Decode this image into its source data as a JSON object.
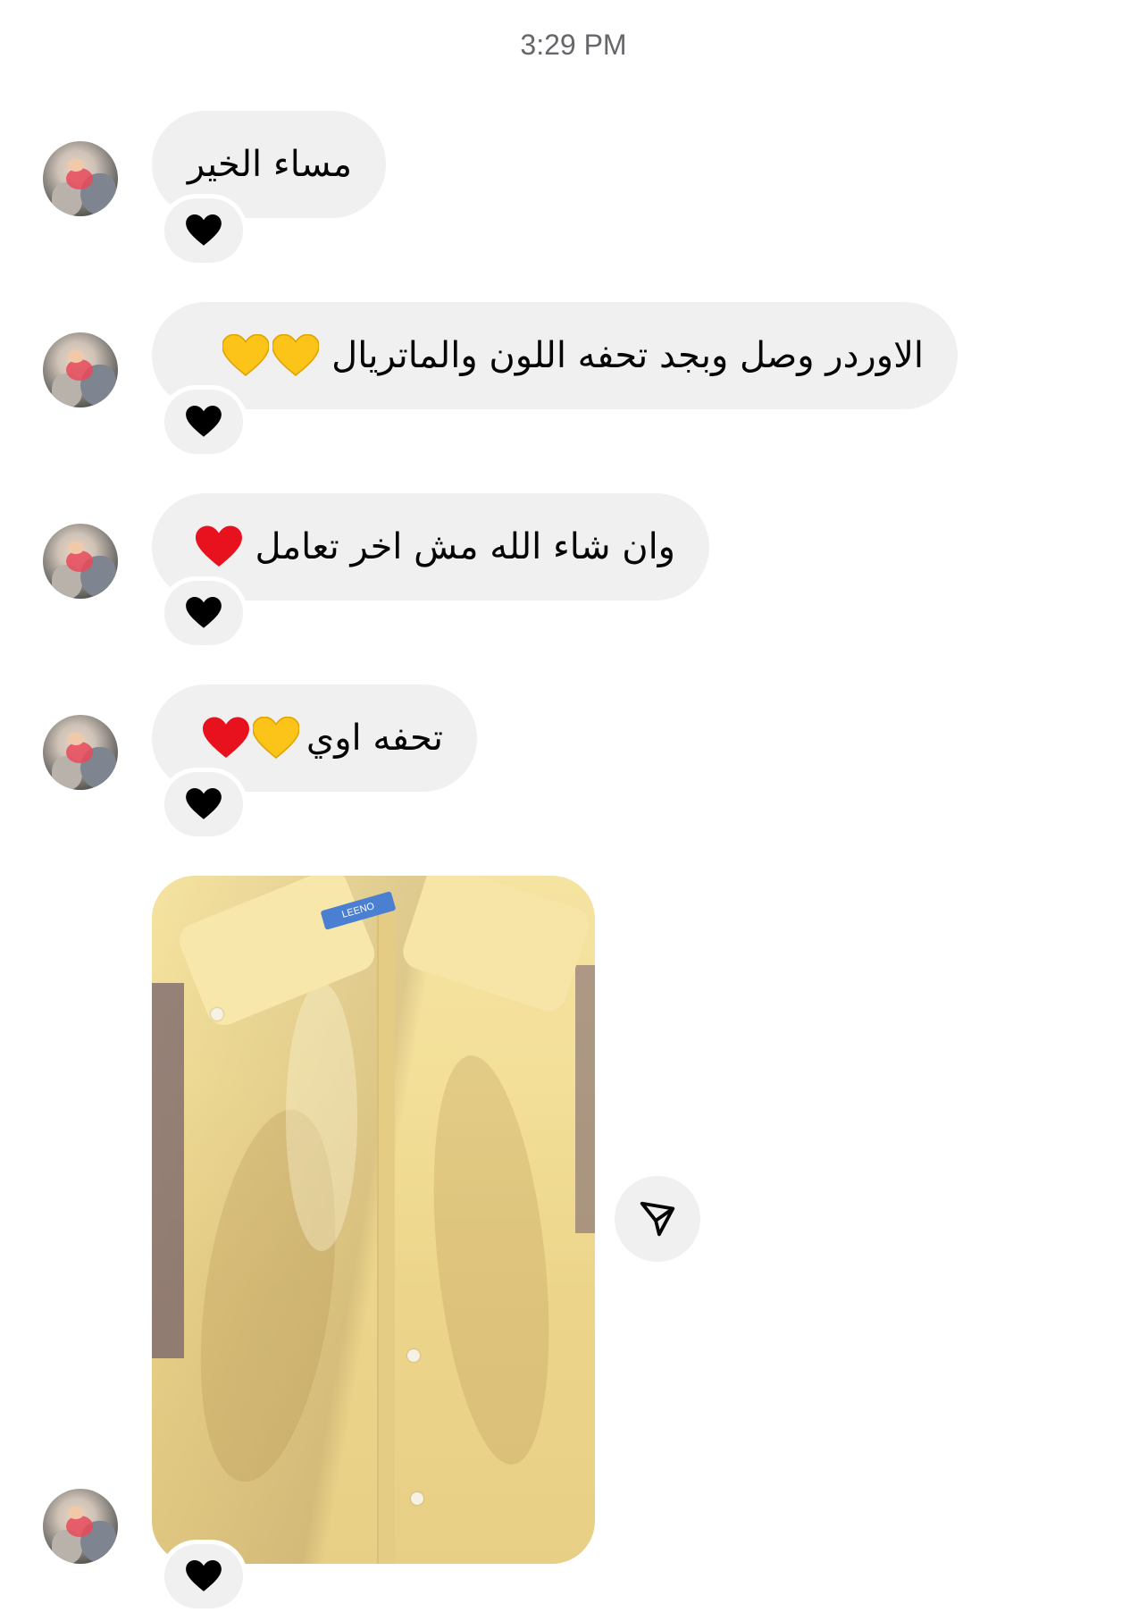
{
  "header": {
    "timestamp": "3:29 PM"
  },
  "messages": [
    {
      "text": "مساء الخير",
      "reaction": "red-heart"
    },
    {
      "text": "الاوردر وصل وبجد تحفه اللون والماتريال",
      "emojis": [
        "yellow-heart",
        "yellow-heart"
      ],
      "reaction": "red-heart"
    },
    {
      "text": "وان شاء الله مش اخر تعامل",
      "emojis": [
        "red-heart"
      ],
      "reaction": "red-heart"
    },
    {
      "text": "تحفه اوي",
      "emojis": [
        "yellow-heart",
        "red-heart"
      ],
      "reaction": "red-heart"
    },
    {
      "type": "photo",
      "description_icon": "yellow-shirt-photo",
      "tag_text": "LEENO",
      "reaction": "red-heart"
    }
  ],
  "actions": {
    "share_icon": "send-icon"
  },
  "colors": {
    "bubble": "#f0f0f0",
    "heart_red": "#e8121f",
    "heart_yellow": "#fcc419",
    "timestamp": "#65676b"
  }
}
